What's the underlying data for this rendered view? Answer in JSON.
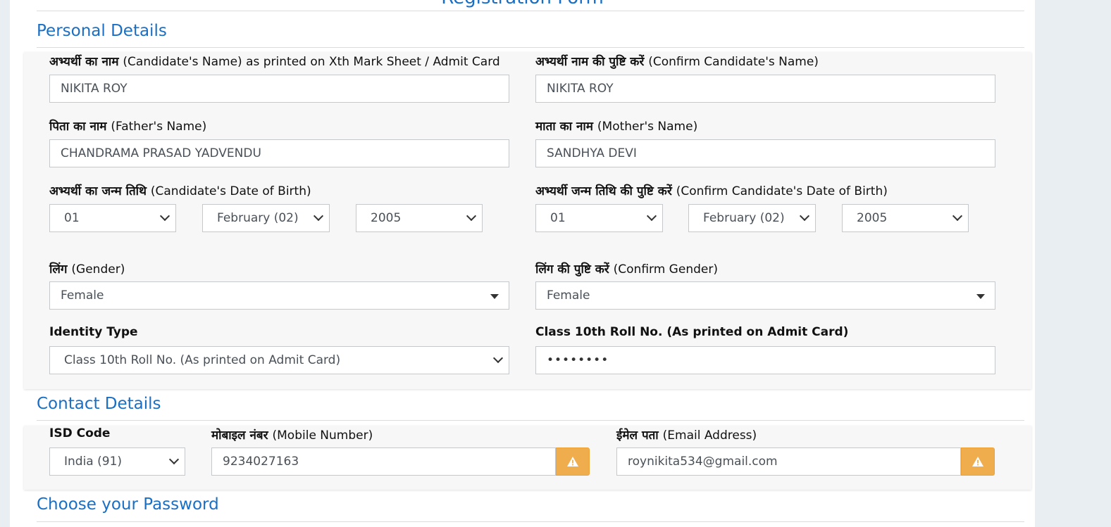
{
  "form_title": "Registration Form",
  "sections": {
    "personal": "Personal Details",
    "contact": "Contact Details",
    "password": "Choose your Password"
  },
  "personal": {
    "name_label_hi": "अभ्यर्थी का नाम",
    "name_label_en": "(Candidate's Name) as printed on Xth Mark Sheet / Admit Card",
    "name_value": "NIKITA ROY",
    "confirm_name_label_hi": "अभ्यर्थी नाम की पुष्टि करें",
    "confirm_name_label_en": "(Confirm Candidate's Name)",
    "confirm_name_value": "NIKITA ROY",
    "father_label_hi": "पिता का नाम",
    "father_label_en": "(Father's Name)",
    "father_value": "CHANDRAMA PRASAD YADVENDU",
    "mother_label_hi": "माता का नाम",
    "mother_label_en": "(Mother's Name)",
    "mother_value": "SANDHYA DEVI",
    "dob_label_hi": "अभ्यर्थी का जन्म तिथि",
    "dob_label_en": "(Candidate's Date of Birth)",
    "dob_day": "01",
    "dob_month": "February (02)",
    "dob_year": "2005",
    "confirm_dob_label_hi": "अभ्यर्थी जन्म तिथि की पुष्टि करें",
    "confirm_dob_label_en": "(Confirm Candidate's Date of Birth)",
    "confirm_dob_day": "01",
    "confirm_dob_month": "February (02)",
    "confirm_dob_year": "2005",
    "gender_label_hi": "लिंग",
    "gender_label_en": "(Gender)",
    "gender_value": "Female",
    "confirm_gender_label_hi": "लिंग की पुष्टि करें",
    "confirm_gender_label_en": "(Confirm Gender)",
    "confirm_gender_value": "Female",
    "identity_type_label": "Identity Type",
    "identity_type_value": "Class 10th Roll No. (As printed on Admit Card)",
    "roll_label": "Class 10th Roll No. (As printed on Admit Card)",
    "roll_value": "••••••••"
  },
  "contact": {
    "isd_label": "ISD Code",
    "isd_value": "India (91)",
    "mobile_label_hi": "मोबाइल नंबर",
    "mobile_label_en": "(Mobile Number)",
    "mobile_value": "9234027163",
    "email_label_hi": "ईमेल पता",
    "email_label_en": "(Email Address)",
    "email_value": "roynikita534@gmail.com"
  },
  "colors": {
    "heading": "#1a6fc4",
    "warning": "#f0ad4e",
    "panel": "#f7f7f7"
  },
  "icons": {
    "mobile_warning": "warning-icon",
    "email_warning": "warning-icon"
  }
}
